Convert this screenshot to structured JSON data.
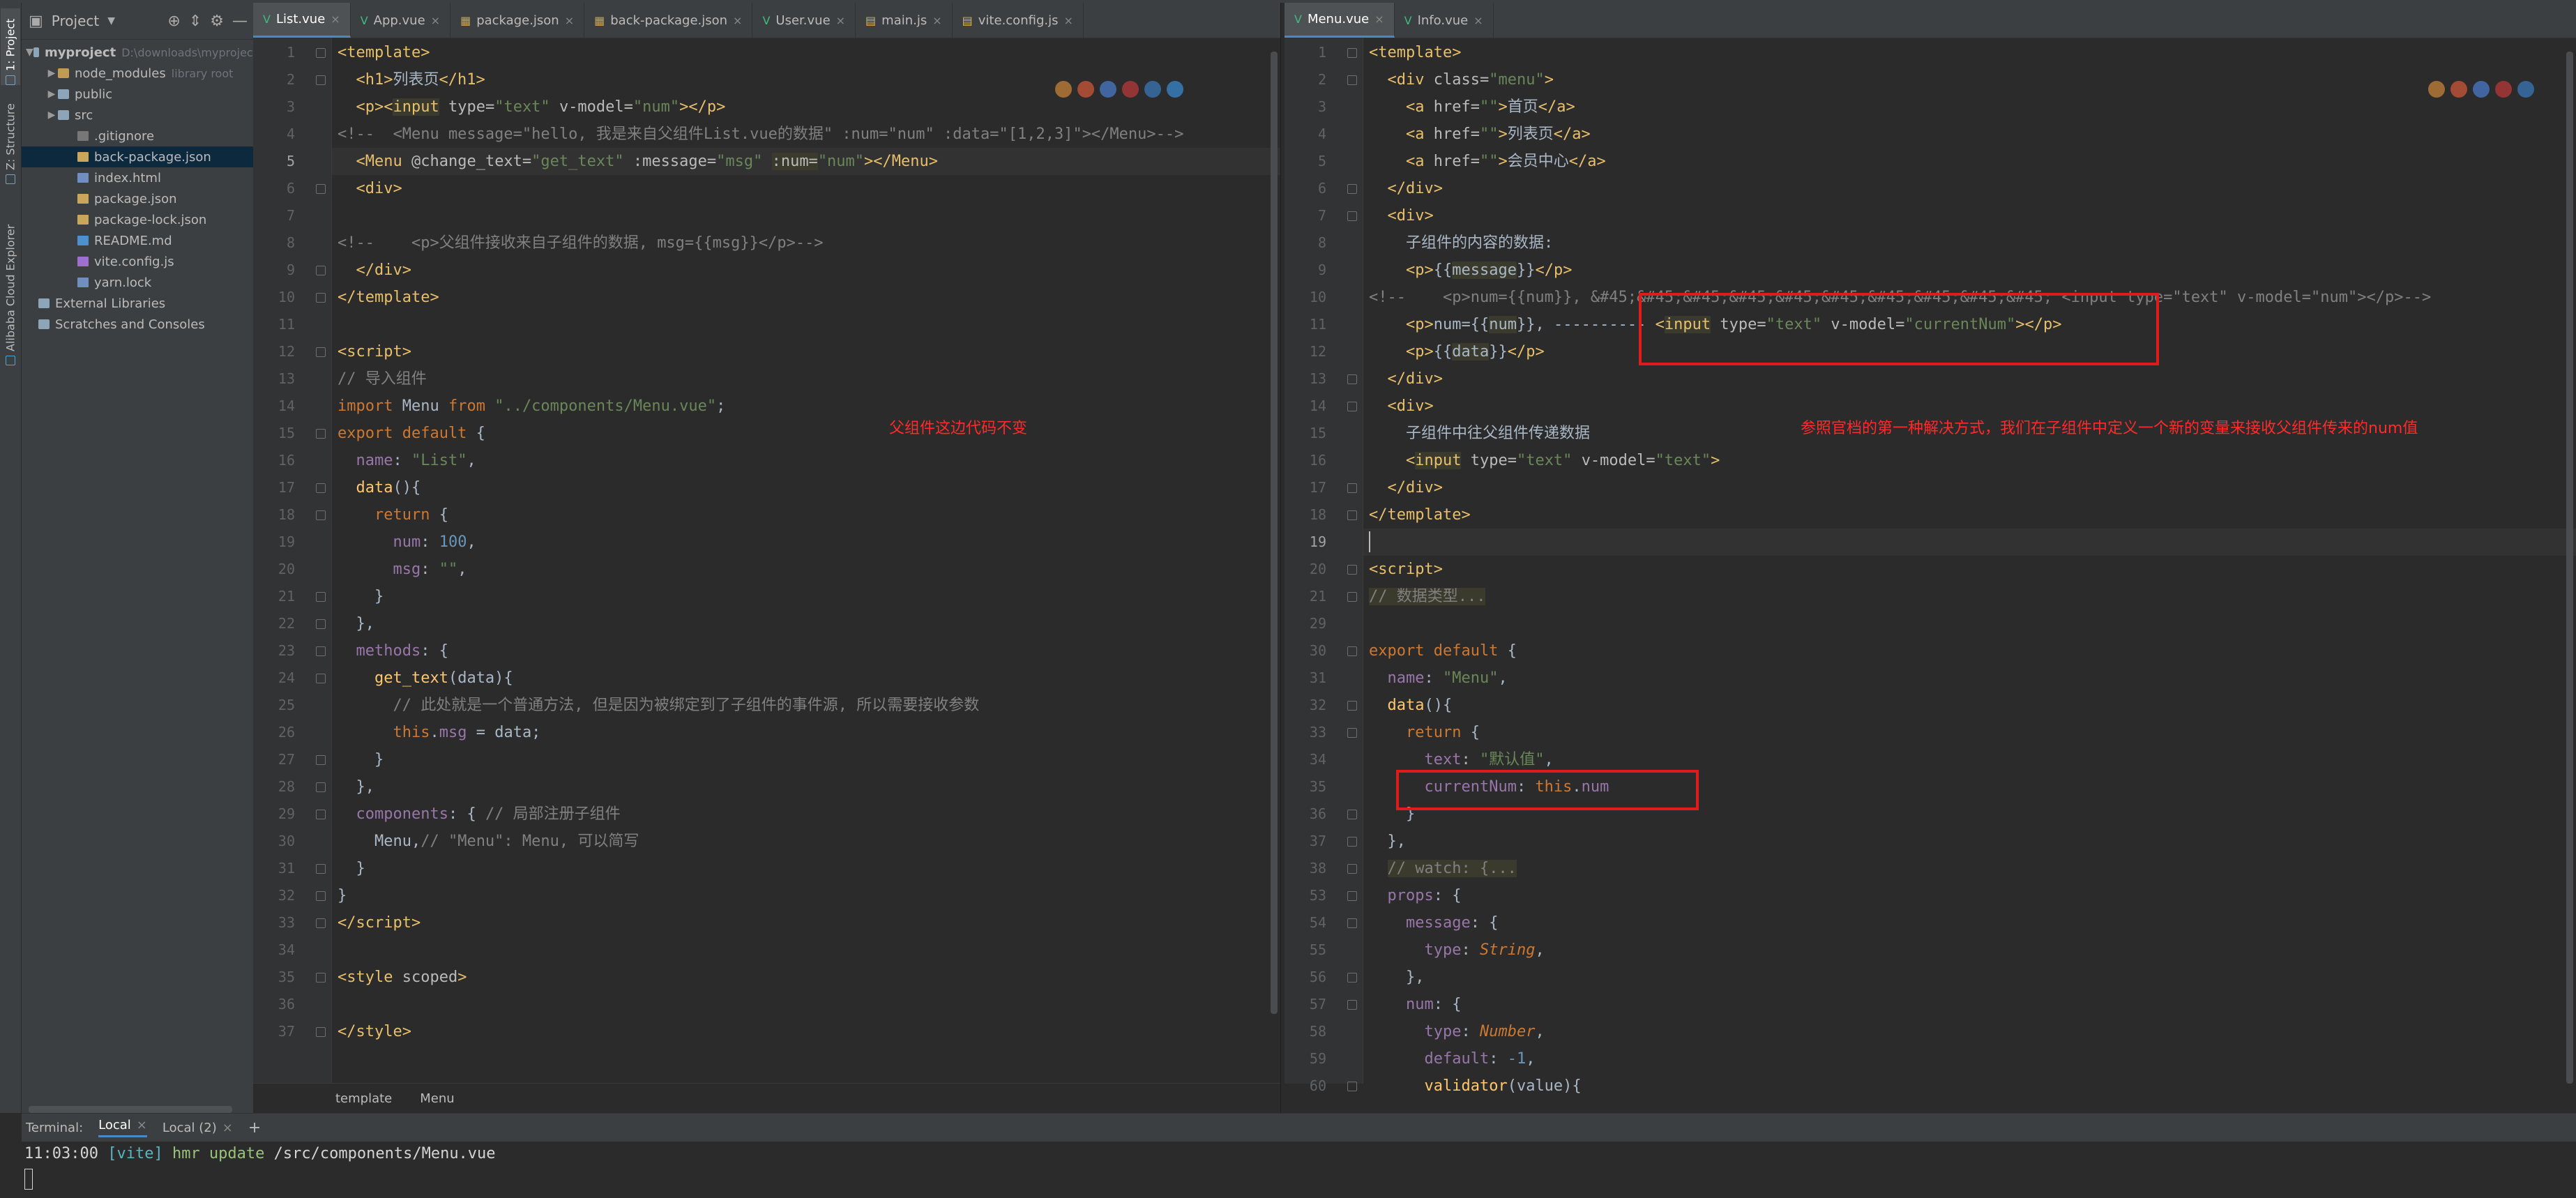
{
  "tool_strip": {
    "project_tab": "1: Project",
    "structure_tab": "Z: Structure",
    "cloud_tab": "Alibaba Cloud Explorer"
  },
  "project_panel": {
    "title": "Project",
    "items": [
      {
        "label": "myproject",
        "extra": "D:\\downloads\\myproject",
        "kind": "folder"
      },
      {
        "label": "node_modules",
        "extra": "library root",
        "kind": "folder-excluded"
      },
      {
        "label": "public",
        "extra": "",
        "kind": "folder"
      },
      {
        "label": "src",
        "extra": "",
        "kind": "folder"
      },
      {
        "label": ".gitignore",
        "extra": "",
        "kind": "git"
      },
      {
        "label": "back-package.json",
        "extra": "",
        "kind": "json"
      },
      {
        "label": "index.html",
        "extra": "",
        "kind": "file"
      },
      {
        "label": "package.json",
        "extra": "",
        "kind": "json"
      },
      {
        "label": "package-lock.json",
        "extra": "",
        "kind": "json"
      },
      {
        "label": "README.md",
        "extra": "",
        "kind": "md"
      },
      {
        "label": "vite.config.js",
        "extra": "",
        "kind": "vite"
      },
      {
        "label": "yarn.lock",
        "extra": "",
        "kind": "file"
      },
      {
        "label": "External Libraries",
        "extra": "",
        "kind": "lib"
      },
      {
        "label": "Scratches and Consoles",
        "extra": "",
        "kind": "lib"
      }
    ]
  },
  "left_editor": {
    "tabs": [
      "List.vue",
      "App.vue",
      "package.json",
      "back-package.json",
      "User.vue",
      "main.js",
      "vite.config.js"
    ],
    "active_tab": "List.vue",
    "current_line": 5,
    "breadcrumb": [
      "template",
      "Menu"
    ],
    "annotation": "父组件这边代码不变"
  },
  "right_editor": {
    "tabs": [
      "Menu.vue",
      "Info.vue"
    ],
    "active_tab": "Menu.vue",
    "current_line": 19,
    "annotation": "参照官档的第一种解决方式，我们在子组件中定义一个新的变量来接收父组件传来的num值"
  },
  "terminal": {
    "label": "Terminal:",
    "tabs": [
      "Local",
      "Local (2)"
    ],
    "add_label": "+",
    "output_time": "11:03:00",
    "output_tag": "[vite]",
    "output_msg": "hmr update",
    "output_path": "/src/components/Menu.vue"
  },
  "colors": {
    "accent": "#4a88c7",
    "annotation_red": "#ff2a2a",
    "box_red": "#e01b1b"
  }
}
